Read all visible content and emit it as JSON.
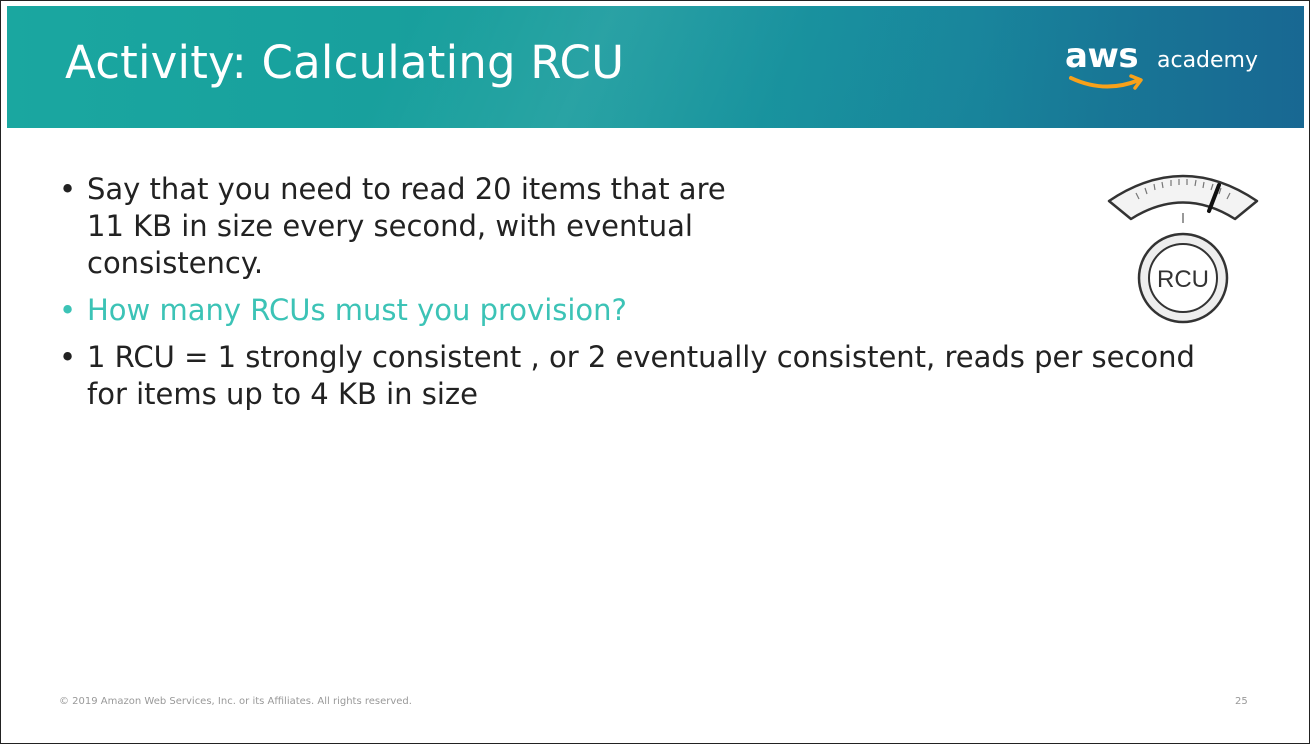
{
  "slide": {
    "title": "Activity: Calculating RCU",
    "logo": {
      "aws": "aws",
      "academy": "academy"
    },
    "bullets": [
      {
        "text": "Say that you need to read 20 items that are 11 KB in size every second, with eventual consistency.",
        "color": "#222222"
      },
      {
        "text": "How many RCUs must you provision?",
        "color": "#3cc3b6"
      },
      {
        "text": "1 RCU = 1 strongly consistent , or 2 eventually consistent, reads per second for items up to 4 KB in size",
        "color": "#222222"
      }
    ],
    "gauge": {
      "label": "RCU",
      "icon": "gauge-icon"
    },
    "footer": "© 2019 Amazon Web Services, Inc. or its Affiliates. All rights reserved.",
    "page_number": "25"
  },
  "colors": {
    "header_teal": "#1aa7a0",
    "header_blue": "#1b6f9a",
    "accent": "#3cc3b6",
    "logo_smile": "#f7a11a"
  }
}
